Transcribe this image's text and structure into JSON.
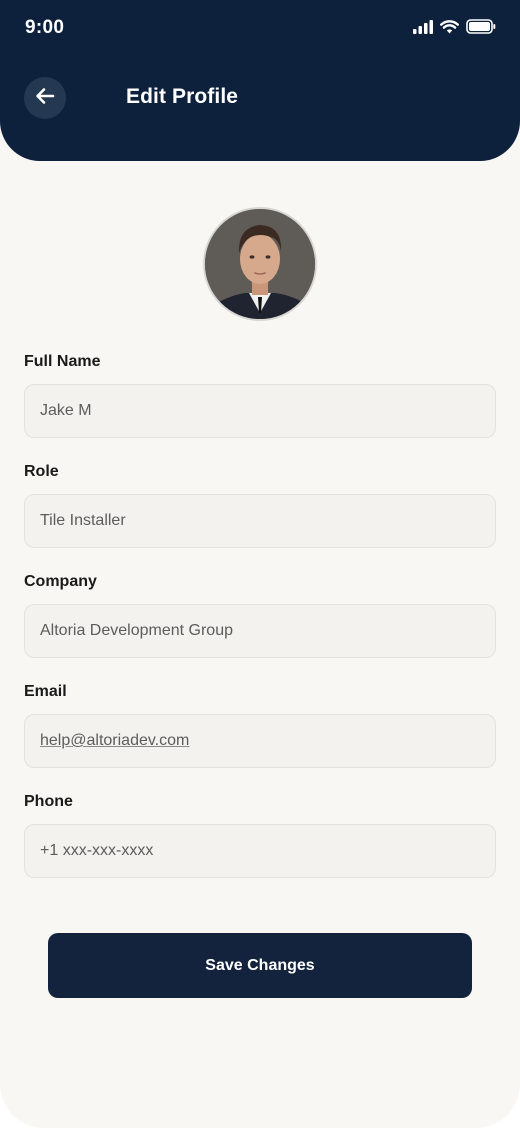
{
  "status_bar": {
    "time": "9:00",
    "icons": [
      "signal-icon",
      "wifi-icon",
      "battery-icon"
    ]
  },
  "header": {
    "back_icon": "arrow-left-icon",
    "title": "Edit Profile"
  },
  "profile": {
    "avatar": "profile-photo"
  },
  "form": {
    "full_name": {
      "label": "Full Name",
      "value": "Jake M"
    },
    "role": {
      "label": "Role",
      "value": "Tile Installer"
    },
    "company": {
      "label": "Company",
      "value": "Altoria Development Group"
    },
    "email": {
      "label": "Email",
      "value": "help@altoriadev.com"
    },
    "phone": {
      "label": "Phone",
      "value": "+1 xxx-xxx-xxxx"
    }
  },
  "actions": {
    "save_label": "Save Changes"
  },
  "colors": {
    "header_bg": "#0d213c",
    "page_bg": "#f8f7f3",
    "input_bg": "#f3f2ee",
    "button_bg": "#13233d"
  }
}
